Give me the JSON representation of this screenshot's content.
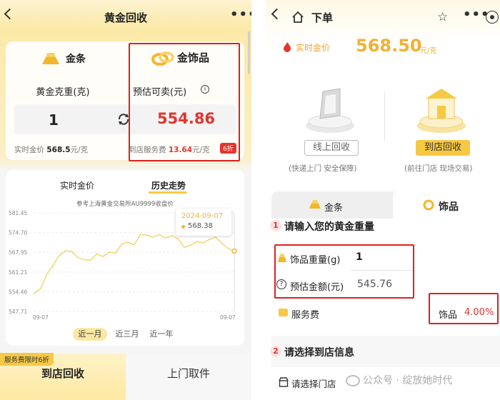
{
  "left": {
    "header": {
      "title": "黄金回收"
    },
    "tabs": [
      {
        "label": "金条"
      },
      {
        "label": "金饰品"
      }
    ],
    "calc": {
      "weight_label": "黄金克重(克)",
      "weight_value": "1",
      "estimate_label": "预估可卖(元)",
      "estimate_value": "554.86",
      "realtime_prefix": "实时金价",
      "realtime_price": "568.5",
      "realtime_unit": "元/克",
      "service_prefix": "到店服务费",
      "service_price": "13.64",
      "service_unit": "元/克",
      "discount_badge": "6折"
    },
    "chart_tabs": [
      {
        "label": "实时金价"
      },
      {
        "label": "历史走势"
      }
    ],
    "chart_caption": "参考上海黄金交易所AU9999收盘价",
    "tooltip": {
      "date": "2024-09-07",
      "value": "568.38"
    },
    "range_buttons": [
      {
        "label": "近一月"
      },
      {
        "label": "近三月"
      },
      {
        "label": "近一年"
      }
    ],
    "promo_badge": "服务费限时6折",
    "bottom_tabs": [
      {
        "label": "到店回收"
      },
      {
        "label": "上门取件"
      }
    ]
  },
  "right": {
    "header": {
      "title": "下单"
    },
    "price": {
      "label": "实时金价",
      "value": "568.50",
      "unit": "元/克"
    },
    "methods": [
      {
        "label": "线上回收",
        "desc": "(快递上门 安全保障)"
      },
      {
        "label": "到店回收",
        "desc": "(前往门店 现场交易)"
      }
    ],
    "type_tabs": [
      {
        "label": "金条"
      },
      {
        "label": "饰品"
      }
    ],
    "step1": {
      "num": "1",
      "title": "请输入您的黄金重量"
    },
    "weight_field": {
      "label": "饰品重量(g)",
      "value": "1"
    },
    "amount_field": {
      "label": "预估金额(元)",
      "value": "545.76"
    },
    "service": {
      "label": "服务费",
      "type": "饰品",
      "rate": "4.00%"
    },
    "step2": {
      "num": "2",
      "title": "请选择到店信息"
    },
    "store": {
      "label": "请选择门店"
    },
    "watermark": "公众号 · 绽放她时代"
  },
  "chart_data": {
    "type": "line",
    "title": "",
    "x_tick_labels": [
      "09-07",
      "09-07"
    ],
    "y_ticks": [
      547.71,
      554.46,
      561.21,
      567.95,
      574.7,
      581.45
    ],
    "ylim": [
      547.71,
      581.45
    ],
    "series": [
      {
        "values": [
          553.8,
          555.5,
          560.4,
          563.5,
          566.8,
          568.5,
          568.2,
          566.1,
          565.4,
          565.3,
          567.4,
          566.5,
          568.0,
          567.7,
          570.8,
          571.4,
          570.5,
          574.1,
          573.8,
          573.2,
          574.0,
          572.9,
          573.7,
          572.6,
          569.6,
          570.4,
          571.6,
          571.2,
          572.3,
          573.1,
          571.1,
          569.3,
          568.4
        ]
      }
    ],
    "highlight": {
      "date": "2024-09-07",
      "value": 568.38
    },
    "colors": {
      "line": "#f3d46a",
      "grid": "#ececec"
    }
  }
}
